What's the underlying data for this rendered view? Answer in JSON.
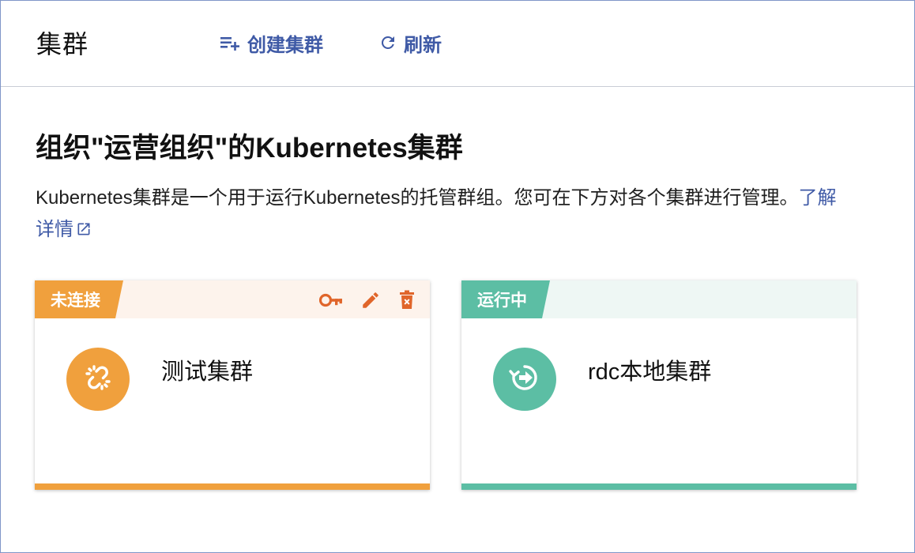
{
  "header": {
    "title": "集群",
    "create_label": "创建集群",
    "refresh_label": "刷新",
    "create_icon": "playlist-add-icon",
    "refresh_icon": "refresh-icon"
  },
  "main": {
    "heading": "组织\"运营组织\"的Kubernetes集群",
    "description": "Kubernetes集群是一个用于运行Kubernetes的托管群组。您可在下方对各个集群进行管理。",
    "learn_more": "了解详情",
    "learn_more_icon": "external-link-icon"
  },
  "clusters": [
    {
      "status": "未连接",
      "name": "测试集群",
      "color": "#f0a03d",
      "icon": "broken-link-icon",
      "actions": [
        "key-icon",
        "edit-icon",
        "delete-icon"
      ]
    },
    {
      "status": "运行中",
      "name": "rdc本地集群",
      "color": "#5cbea4",
      "icon": "sync-arrow-icon"
    }
  ],
  "colors": {
    "accent": "#3f5aa6",
    "warning": "#f0a03d",
    "warning_action": "#e0652a",
    "running": "#5cbea4"
  }
}
